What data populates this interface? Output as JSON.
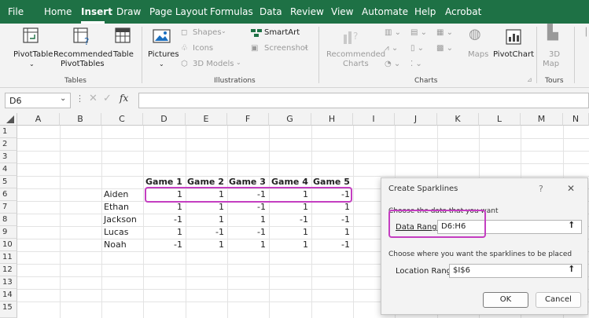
{
  "menu": [
    "File",
    "Home",
    "Insert",
    "Draw",
    "Page Layout",
    "Formulas",
    "Data",
    "Review",
    "View",
    "Automate",
    "Help",
    "Acrobat"
  ],
  "ribbon": {
    "tables": {
      "pivot": "PivotTable",
      "recommended1": "Recommended",
      "recommended2": "PivotTables",
      "table": "Table",
      "label": "Tables"
    },
    "illustrations": {
      "pictures": "Pictures",
      "shapes": "Shapes",
      "icons": "Icons",
      "models": "3D Models",
      "smartart": "SmartArt",
      "screenshot": "Screenshot",
      "label": "Illustrations"
    },
    "charts": {
      "recommended1": "Recommended",
      "recommended2": "Charts",
      "maps": "Maps",
      "pivotchart": "PivotChart",
      "label": "Charts"
    },
    "tours": {
      "map1": "3D",
      "map2": "Map",
      "label": "Tours"
    }
  },
  "formula": {
    "namebox": "D6",
    "fx": "fx",
    "value": ""
  },
  "sheet": {
    "columns": [
      "A",
      "B",
      "C",
      "D",
      "E",
      "F",
      "G",
      "H",
      "I",
      "J",
      "K",
      "L",
      "M",
      "N"
    ],
    "rows": [
      "1",
      "2",
      "3",
      "4",
      "5",
      "6",
      "7",
      "8",
      "9",
      "10",
      "11",
      "12",
      "13",
      "14",
      "15"
    ],
    "headers": [
      "Game 1",
      "Game 2",
      "Game 3",
      "Game 4",
      "Game 5"
    ],
    "players": [
      {
        "name": "Aiden",
        "scores": [
          "1",
          "1",
          "-1",
          "1",
          "-1"
        ]
      },
      {
        "name": "Ethan",
        "scores": [
          "1",
          "1",
          "-1",
          "1",
          "1"
        ]
      },
      {
        "name": "Jackson",
        "scores": [
          "-1",
          "1",
          "1",
          "-1",
          "-1"
        ]
      },
      {
        "name": "Lucas",
        "scores": [
          "1",
          "-1",
          "-1",
          "1",
          "1"
        ]
      },
      {
        "name": "Noah",
        "scores": [
          "-1",
          "1",
          "1",
          "1",
          "-1"
        ]
      }
    ]
  },
  "dialog": {
    "title": "Create Sparklines",
    "help": "?",
    "close": "✕",
    "choose_data": "Choose the data that you want",
    "data_range_label": "Data Range:",
    "data_range_value": "D6:H6",
    "choose_place": "Choose where you want the sparklines to be placed",
    "location_label": "Location Range:",
    "location_value": "$I$6",
    "ok": "OK",
    "cancel": "Cancel"
  },
  "colors": {
    "accent": "#1e7145",
    "highlight": "#c43ec1"
  }
}
